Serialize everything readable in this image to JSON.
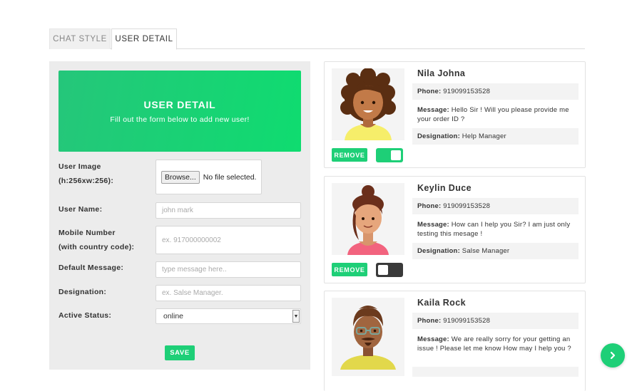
{
  "tabs": [
    {
      "label": "CHAT STYLE",
      "active": false
    },
    {
      "label": "USER DETAIL",
      "active": true
    }
  ],
  "form": {
    "banner_title": "USER DETAIL",
    "banner_subtitle": "Fill out the form below to add new user!",
    "user_image_label_1": "User Image",
    "user_image_label_2": "(h:256xw:256):",
    "browse_label": "Browse...",
    "no_file_text": "No file selected.",
    "user_name_label": "User Name:",
    "user_name_placeholder": "john mark",
    "mobile_label_1": "Mobile Number",
    "mobile_label_2": "(with country code):",
    "mobile_placeholder": "ex. 917000000002",
    "default_message_label": "Default Message:",
    "default_message_placeholder": "type message here..",
    "designation_label": "Designation:",
    "designation_placeholder": "ex. Salse Manager.",
    "active_status_label": "Active Status:",
    "active_status_value": "online",
    "save_label": "SAVE"
  },
  "users": [
    {
      "name": "Nila Johna",
      "phone_label": "Phone:",
      "phone": "919099153528",
      "message_label": "Message:",
      "message": "Hello Sir ! Will you please provide me your order ID ?",
      "designation_label": "Designation:",
      "designation": "Help Manager",
      "remove_label": "REMOVE",
      "active": true
    },
    {
      "name": "Keylin Duce",
      "phone_label": "Phone:",
      "phone": "919099153528",
      "message_label": "Message:",
      "message": "How can I help you Sir? I am just only testing this mesage !",
      "designation_label": "Designation:",
      "designation": "Salse Manager",
      "remove_label": "REMOVE",
      "active": false
    },
    {
      "name": "Kaila Rock",
      "phone_label": "Phone:",
      "phone": "919099153528",
      "message_label": "Message:",
      "message": "We are really sorry for your getting an issue ! Please let me know How may I help you ?"
    }
  ],
  "colors": {
    "accent": "#1ecf77",
    "toggle_off": "#3a3a3a",
    "panel_bg": "#ececec"
  },
  "icons": {
    "next": "chevron-right-icon"
  }
}
